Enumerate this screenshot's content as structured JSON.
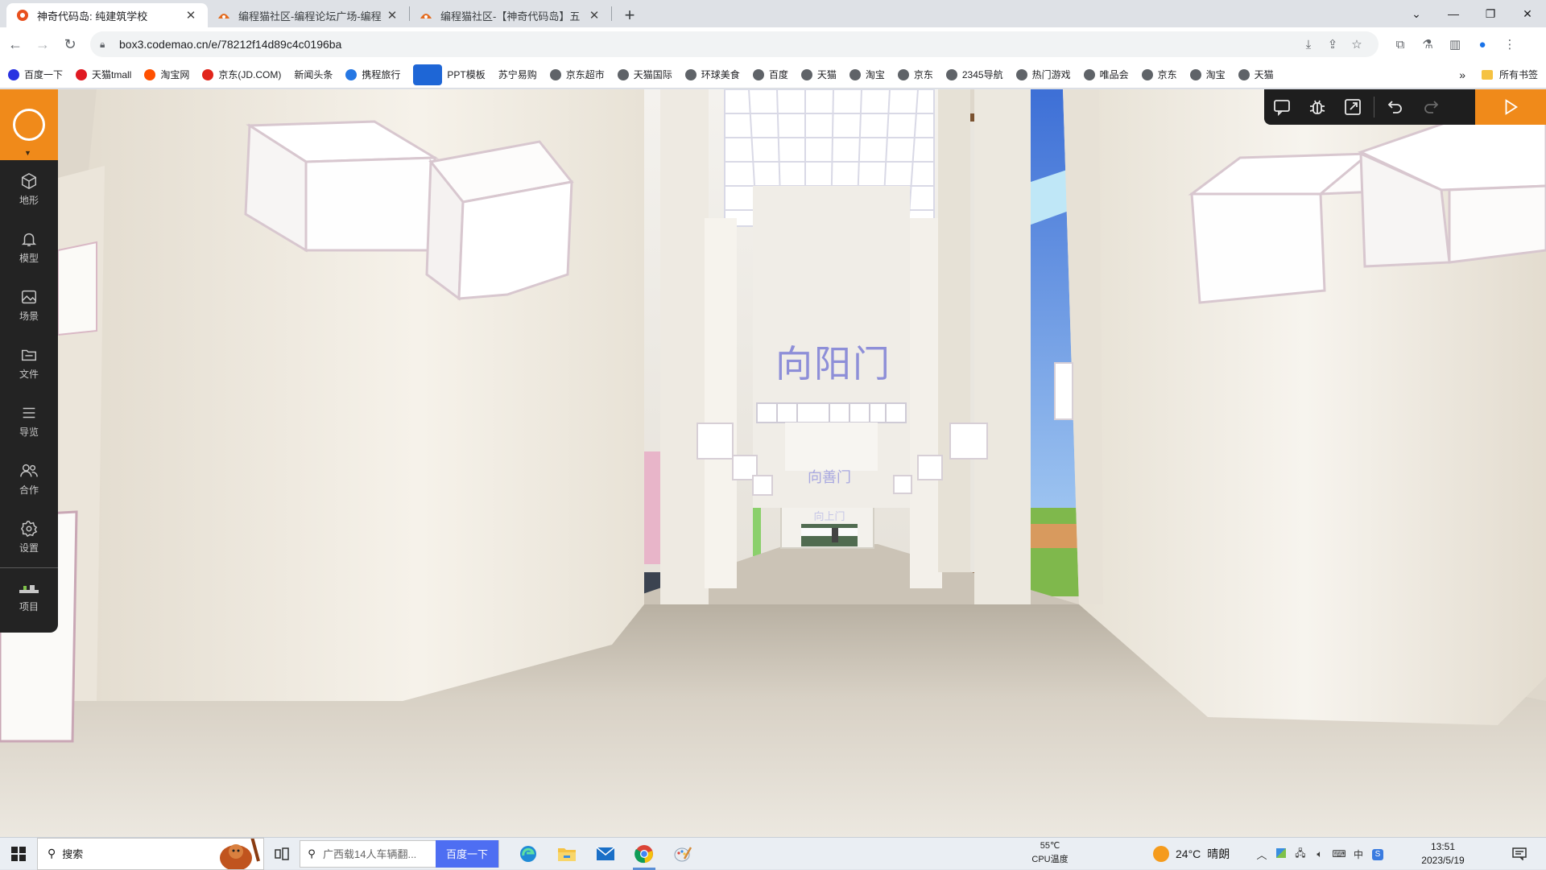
{
  "browser": {
    "tabs": [
      {
        "title": "神奇代码岛: 纯建筑学校",
        "active": true
      },
      {
        "title": "编程猫社区-编程论坛广场-编程",
        "active": false
      },
      {
        "title": "编程猫社区-【神奇代码岛】五",
        "active": false
      }
    ],
    "url": "box3.codemao.cn/e/78212f14d89c4c0196ba"
  },
  "bookmarks": [
    {
      "label": "百度一下",
      "icon": "baidu-icon"
    },
    {
      "label": "天猫tmall",
      "icon": "tmall-icon"
    },
    {
      "label": "淘宝网",
      "icon": "taobao-icon"
    },
    {
      "label": "京东(JD.COM)",
      "icon": "jd-icon"
    },
    {
      "label": "新闻头条",
      "icon": "news-icon"
    },
    {
      "label": "携程旅行",
      "icon": "ctrip-icon"
    },
    {
      "label": "PPT模板",
      "icon": "ppt-icon"
    },
    {
      "label": "苏宁易购",
      "icon": "suning-icon"
    },
    {
      "label": "京东超市",
      "icon": "globe-icon"
    },
    {
      "label": "天猫国际",
      "icon": "globe-icon"
    },
    {
      "label": "环球美食",
      "icon": "globe-icon"
    },
    {
      "label": "百度",
      "icon": "globe-icon"
    },
    {
      "label": "天猫",
      "icon": "globe-icon"
    },
    {
      "label": "淘宝",
      "icon": "globe-icon"
    },
    {
      "label": "京东",
      "icon": "globe-icon"
    },
    {
      "label": "2345导航",
      "icon": "globe-icon"
    },
    {
      "label": "热门游戏",
      "icon": "globe-icon"
    },
    {
      "label": "唯品会",
      "icon": "globe-icon"
    },
    {
      "label": "京东",
      "icon": "globe-icon"
    },
    {
      "label": "淘宝",
      "icon": "globe-icon"
    },
    {
      "label": "天猫",
      "icon": "globe-icon"
    }
  ],
  "bookmarks_overflow": "»",
  "bookmarks_all": "所有书签",
  "sidebar": {
    "items": [
      {
        "label": "地形",
        "icon": "cube-icon"
      },
      {
        "label": "模型",
        "icon": "bell-icon"
      },
      {
        "label": "场景",
        "icon": "image-icon"
      },
      {
        "label": "文件",
        "icon": "folder-icon"
      },
      {
        "label": "导览",
        "icon": "list-icon"
      },
      {
        "label": "合作",
        "icon": "users-icon"
      },
      {
        "label": "设置",
        "icon": "gear-icon"
      },
      {
        "label": "项目",
        "icon": "project-icon"
      }
    ]
  },
  "scene": {
    "sign_main": "向阳门",
    "sign_second": "向善门",
    "sign_third": "向上门"
  },
  "taskbar": {
    "search_label": "搜索",
    "baidu_placeholder": "广西载14人车辆翻...",
    "baidu_button": "百度一下",
    "cpu_temp": "55℃",
    "cpu_label": "CPU温度",
    "weather_temp": "24°C",
    "weather_desc": "晴朗",
    "time": "13:51",
    "date": "2023/5/19"
  },
  "colors": {
    "accent_orange": "#f08a1a",
    "sidebar_bg": "#232323",
    "sign_text": "#8e8fd8"
  }
}
